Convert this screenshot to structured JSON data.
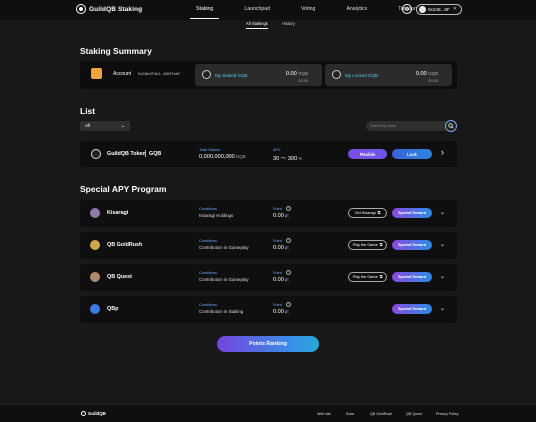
{
  "header": {
    "logo_text": "GuildQB Staking",
    "nav": [
      "Staking",
      "Launchpad",
      "Voting",
      "Analytics",
      "Treasury"
    ],
    "wallet_address": "0x248...5F"
  },
  "subnav": [
    "All Stakings",
    "History"
  ],
  "summary": {
    "title": "Staking Summary",
    "account_label": "Account",
    "account_address": "0x248c2F4A1...40BF1bbF",
    "staked_label": "My Staked GQB",
    "staked_value": "0.00",
    "staked_unit": "GQB",
    "staked_usd": "$ 0.00",
    "locked_label": "My Locked GQB",
    "locked_value": "0.00",
    "locked_unit": "GQB",
    "locked_usd": "$ 0.00"
  },
  "list": {
    "title": "List",
    "filter_value": "All",
    "search_placeholder": "Search by name"
  },
  "token": {
    "name": "GuildQB Token",
    "symbol": "GQB",
    "total_label": "Total Staked",
    "total_value": "0,000,000,000",
    "total_unit": "GQB",
    "apy_label": "APY",
    "apy_value": "30 ～ 300",
    "apy_unit": "%",
    "flexible_label": "Flexible",
    "lock_label": "Lock"
  },
  "program": {
    "title": "Special APY Program",
    "conditions_label": "Conditions",
    "point_label": "Point",
    "point_unit": "pt",
    "special_label": "Special Reward",
    "rows": [
      {
        "name": "Kisaragi",
        "condition": "Kisaragi Holdings",
        "point": "0.00",
        "action": "Get Kisaragi",
        "icon_color": "#8e7aa8"
      },
      {
        "name": "QB GoldRush",
        "condition": "Contribution in Gameplay",
        "point": "0.00",
        "action": "Play the Game",
        "icon_color": "#d0a648"
      },
      {
        "name": "QB Quest",
        "condition": "Contribution in Gameplay",
        "point": "0.00",
        "action": "Play the Game",
        "icon_color": "#b08a6a"
      },
      {
        "name": "QBp",
        "condition": "Contribution in Staking",
        "point": "0.00",
        "action": "",
        "icon_color": "#3a7be0"
      }
    ]
  },
  "ranking_label": "Points Ranking",
  "footer": {
    "logo_text": "GuildQB",
    "links": [
      "Web site",
      "Docs",
      "QB GoldRush",
      "QB Quest",
      "Privacy Policy"
    ]
  }
}
